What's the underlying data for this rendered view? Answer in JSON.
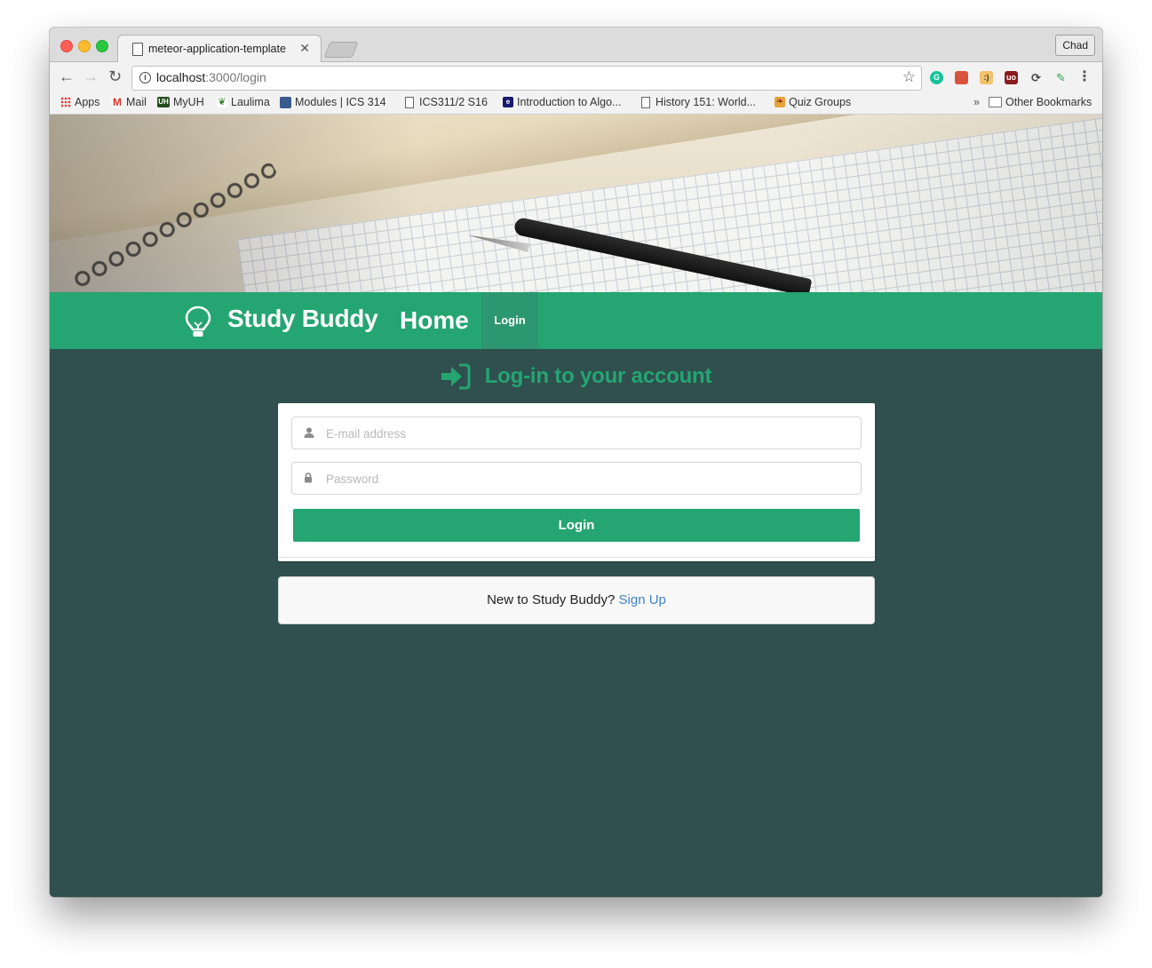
{
  "browser": {
    "tab_title": "meteor-application-template",
    "profile_name": "Chad",
    "url_host": "localhost",
    "url_path": ":3000/login",
    "bookmarks": [
      {
        "label": "Apps",
        "icon": "apps-grid-icon"
      },
      {
        "label": "Mail",
        "icon": "gmail-icon"
      },
      {
        "label": "MyUH",
        "icon": "uh-icon"
      },
      {
        "label": "Laulima",
        "icon": "leaf-icon"
      },
      {
        "label": "Modules | ICS 314",
        "icon": "square-icon"
      },
      {
        "label": "ICS311/2 S16",
        "icon": "document-icon"
      },
      {
        "label": "Introduction to Algo...",
        "icon": "site-icon"
      },
      {
        "label": "History 151: World...",
        "icon": "document-icon"
      },
      {
        "label": "Quiz Groups",
        "icon": "sandals-icon"
      }
    ],
    "other_bookmarks": "Other Bookmarks",
    "overflow": "»"
  },
  "navbar": {
    "brand": "Study Buddy",
    "home": "Home",
    "login": "Login"
  },
  "login": {
    "header": "Log-in to your account",
    "email_placeholder": "E-mail address",
    "email_value": "",
    "password_placeholder": "Password",
    "password_value": "",
    "button_label": "Login",
    "signup_prompt": "New to Study Buddy?",
    "signup_link": "Sign Up"
  },
  "colors": {
    "accent": "#24a572",
    "page_background": "#2f504e",
    "link": "#4183c4"
  }
}
